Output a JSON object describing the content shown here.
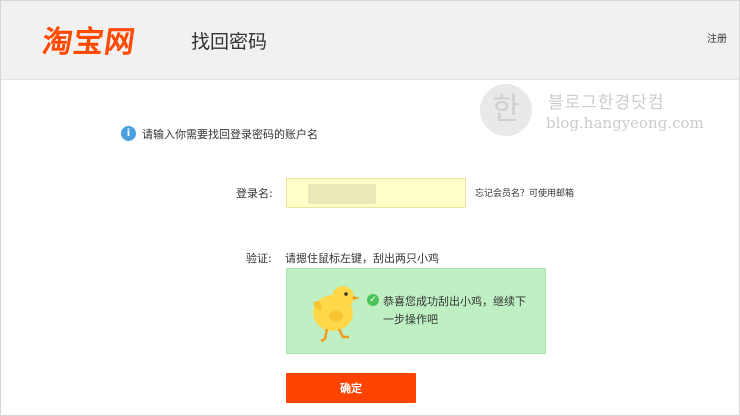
{
  "header": {
    "logo_text": "淘宝网",
    "page_title": "找回密码",
    "register_link": "注册"
  },
  "watermark": {
    "glyph": "한",
    "title": "블로그한경닷컴",
    "url": "blog.hangyeong.com"
  },
  "form": {
    "info_text": "请输入你需要找回登录密码的账户名",
    "username_label": "登录名:",
    "username_value": "",
    "forgot_link": "忘记会员名？可使用邮箱",
    "verify_label": "验证:",
    "verify_hint": "请摁住鼠标左键，刮出两只小鸡",
    "success_text": "恭喜您成功刮出小鸡，继续下一步操作吧",
    "confirm_button": "确定"
  },
  "colors": {
    "brand": "#ff4400",
    "verify_bg": "#bff0c4",
    "input_bg": "#ffffc8",
    "info_icon": "#4a9fe0",
    "success_icon": "#4cc35a"
  },
  "icons": {
    "info": "info-icon",
    "success": "check-circle-icon",
    "chick": "chick-illustration"
  }
}
